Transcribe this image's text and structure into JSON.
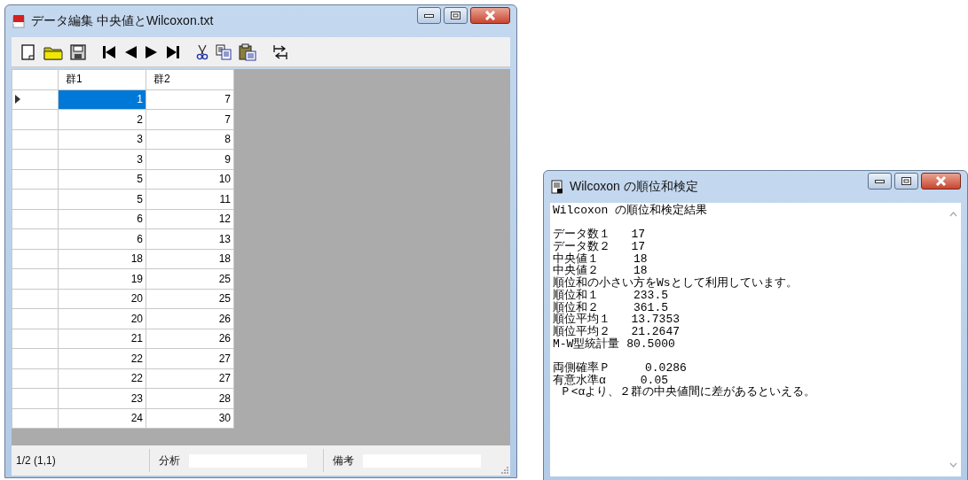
{
  "data_window": {
    "title": "データ編集 中央値とWilcoxon.txt",
    "grid": {
      "columns": [
        "群1",
        "群2"
      ],
      "rows": [
        {
          "current": true,
          "cells": [
            {
              "text": "1",
              "selected": true
            },
            {
              "text": "7",
              "selected": false
            }
          ]
        },
        {
          "current": false,
          "cells": [
            {
              "text": "2",
              "selected": false
            },
            {
              "text": "7",
              "selected": false
            }
          ]
        },
        {
          "current": false,
          "cells": [
            {
              "text": "3",
              "selected": false
            },
            {
              "text": "8",
              "selected": false
            }
          ]
        },
        {
          "current": false,
          "cells": [
            {
              "text": "3",
              "selected": false
            },
            {
              "text": "9",
              "selected": false
            }
          ]
        },
        {
          "current": false,
          "cells": [
            {
              "text": "5",
              "selected": false
            },
            {
              "text": "10",
              "selected": false
            }
          ]
        },
        {
          "current": false,
          "cells": [
            {
              "text": "5",
              "selected": false
            },
            {
              "text": "11",
              "selected": false
            }
          ]
        },
        {
          "current": false,
          "cells": [
            {
              "text": "6",
              "selected": false
            },
            {
              "text": "12",
              "selected": false
            }
          ]
        },
        {
          "current": false,
          "cells": [
            {
              "text": "6",
              "selected": false
            },
            {
              "text": "13",
              "selected": false
            }
          ]
        },
        {
          "current": false,
          "cells": [
            {
              "text": "18",
              "selected": false
            },
            {
              "text": "18",
              "selected": false
            }
          ]
        },
        {
          "current": false,
          "cells": [
            {
              "text": "19",
              "selected": false
            },
            {
              "text": "25",
              "selected": false
            }
          ]
        },
        {
          "current": false,
          "cells": [
            {
              "text": "20",
              "selected": false
            },
            {
              "text": "25",
              "selected": false
            }
          ]
        },
        {
          "current": false,
          "cells": [
            {
              "text": "20",
              "selected": false
            },
            {
              "text": "26",
              "selected": false
            }
          ]
        },
        {
          "current": false,
          "cells": [
            {
              "text": "21",
              "selected": false
            },
            {
              "text": "26",
              "selected": false
            }
          ]
        },
        {
          "current": false,
          "cells": [
            {
              "text": "22",
              "selected": false
            },
            {
              "text": "27",
              "selected": false
            }
          ]
        },
        {
          "current": false,
          "cells": [
            {
              "text": "22",
              "selected": false
            },
            {
              "text": "27",
              "selected": false
            }
          ]
        },
        {
          "current": false,
          "cells": [
            {
              "text": "23",
              "selected": false
            },
            {
              "text": "28",
              "selected": false
            }
          ]
        },
        {
          "current": false,
          "cells": [
            {
              "text": "24",
              "selected": false
            },
            {
              "text": "30",
              "selected": false
            }
          ]
        }
      ]
    },
    "status_bar": {
      "position": "1/2 (1,1)",
      "fields": [
        {
          "label": "分析"
        },
        {
          "label": "備考"
        }
      ]
    }
  },
  "result_window": {
    "title": "Wilcoxon の順位和検定",
    "paragraphs": [
      [
        "Wilcoxon の順位和検定結果"
      ],
      [
        "データ数１   17",
        "データ数２   17",
        "中央値１     18",
        "中央値２     18",
        "順位和の小さい方をWsとして利用しています。",
        "順位和１     233.5",
        "順位和２     361.5",
        "順位平均１   13.7353",
        "順位平均２   21.2647",
        "M-W型統計量 80.5000"
      ],
      [
        "両側確率Ｐ     0.0286",
        "有意水準α     0.05",
        " Ｐ<αより、２群の中央値間に差があるといえる。"
      ]
    ]
  }
}
